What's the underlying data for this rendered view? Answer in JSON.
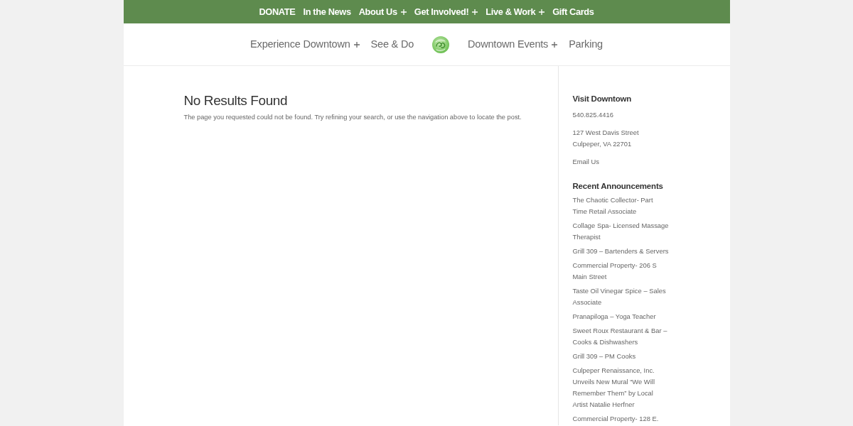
{
  "top_menu": [
    {
      "label": "DONATE",
      "has_submenu": false
    },
    {
      "label": "In the News",
      "has_submenu": false
    },
    {
      "label": "About Us",
      "has_submenu": true
    },
    {
      "label": "Get Involved!",
      "has_submenu": true
    },
    {
      "label": "Live & Work",
      "has_submenu": true
    },
    {
      "label": "Gift Cards",
      "has_submenu": false
    }
  ],
  "main_menu": [
    {
      "kind": "link",
      "label": "Experience Downtown",
      "has_submenu": true
    },
    {
      "kind": "link",
      "label": "See & Do",
      "has_submenu": false
    },
    {
      "kind": "logo"
    },
    {
      "kind": "link",
      "label": "Downtown Events",
      "has_submenu": true
    },
    {
      "kind": "link",
      "label": "Parking",
      "has_submenu": false
    }
  ],
  "content": {
    "title": "No Results Found",
    "message": "The page you requested could not be found. Try refining your search, or use the navigation above to locate the post."
  },
  "sidebar": {
    "widgets": [
      {
        "title": "Visit Downtown",
        "blocks": [
          {
            "kind": "text",
            "lines": [
              "540.825.4416"
            ]
          },
          {
            "kind": "text",
            "lines": [
              "127 West Davis Street",
              "Culpeper, VA 22701"
            ]
          },
          {
            "kind": "link",
            "lines": [
              "Email Us"
            ]
          }
        ]
      },
      {
        "title": "Recent Announcements",
        "blocks": [
          {
            "kind": "link",
            "lines": [
              "The Chaotic Collector- Part Time Retail Associate"
            ]
          },
          {
            "kind": "link",
            "lines": [
              "Collage Spa- Licensed Massage Therapist"
            ]
          },
          {
            "kind": "link",
            "lines": [
              "Grill 309 – Bartenders & Servers"
            ]
          },
          {
            "kind": "link",
            "lines": [
              "Commercial Property- 206 S Main Street"
            ]
          },
          {
            "kind": "link",
            "lines": [
              "Taste Oil Vinegar Spice – Sales Associate"
            ]
          },
          {
            "kind": "link",
            "lines": [
              "Pranapiloga – Yoga Teacher"
            ]
          },
          {
            "kind": "link",
            "lines": [
              "Sweet Roux Restaurant & Bar – Cooks & Dishwashers"
            ]
          },
          {
            "kind": "link",
            "lines": [
              "Grill 309 – PM Cooks"
            ]
          },
          {
            "kind": "link",
            "lines": [
              "Culpeper Renaissance, Inc. Unveils New Mural “We Will Remember Them” by Local Artist Natalie Herfner"
            ]
          },
          {
            "kind": "link",
            "lines": [
              "Commercial Property- 128 E."
            ]
          }
        ]
      }
    ]
  }
}
